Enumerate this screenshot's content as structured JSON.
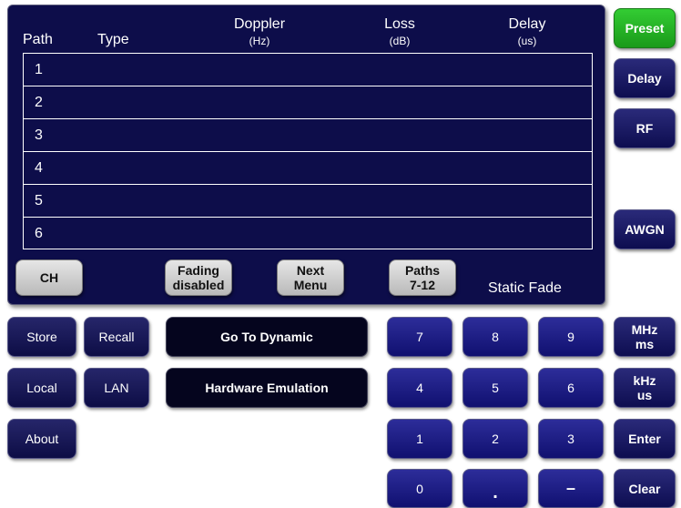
{
  "table": {
    "headers": {
      "path": "Path",
      "type": "Type",
      "doppler": "Doppler",
      "doppler_unit": "(Hz)",
      "loss": "Loss",
      "loss_unit": "(dB)",
      "delay": "Delay",
      "delay_unit": "(us)"
    },
    "rows": [
      "1",
      "2",
      "3",
      "4",
      "5",
      "6"
    ]
  },
  "panel_buttons": {
    "ch": "CH",
    "fading_line1": "Fading",
    "fading_line2": "disabled",
    "next_line1": "Next",
    "next_line2": "Menu",
    "paths_line1": "Paths",
    "paths_line2": "7-12"
  },
  "status": {
    "fade_mode": "Static Fade"
  },
  "softkeys": {
    "preset": "Preset",
    "delay": "Delay",
    "rf": "RF",
    "awgn": "AWGN"
  },
  "nav": {
    "store": "Store",
    "recall": "Recall",
    "local": "Local",
    "lan": "LAN",
    "about": "About",
    "go_dynamic": "Go To Dynamic",
    "hw_emulation": "Hardware Emulation"
  },
  "keypad": {
    "k7": "7",
    "k8": "8",
    "k9": "9",
    "k4": "4",
    "k5": "5",
    "k6": "6",
    "k1": "1",
    "k2": "2",
    "k3": "3",
    "k0": "0",
    "dot": ".",
    "minus": "–",
    "mhz_line1": "MHz",
    "mhz_line2": "ms",
    "khz_line1": "kHz",
    "khz_line2": "us",
    "enter": "Enter",
    "clear": "Clear"
  },
  "colors": {
    "panel_bg": "#0d0d4a",
    "preset_green": "#2eb82e",
    "key_blue": "#1a1a80"
  }
}
